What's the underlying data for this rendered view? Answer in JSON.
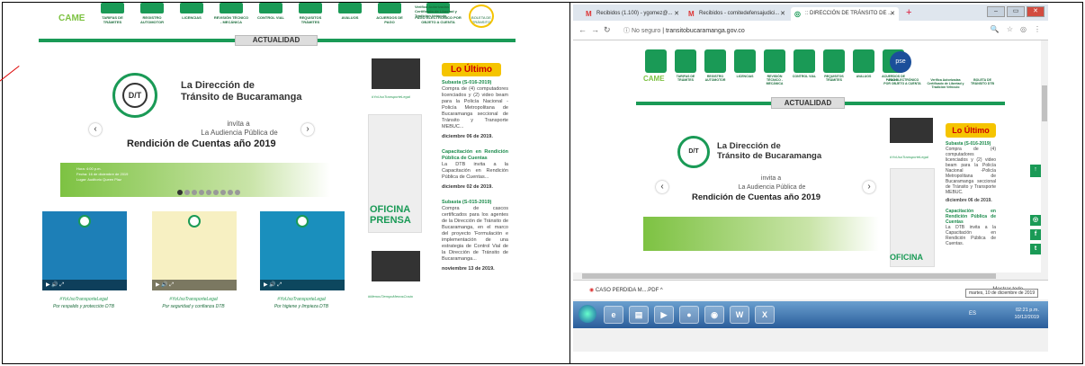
{
  "left": {
    "nav_items": [
      "TARIFAS DE TRÁMITES",
      "REGISTRO AUTOMOTOR",
      "LICENCIAS",
      "REVISIÓN TÉCNICO - MECÁNICA",
      "CONTROL VIAL",
      "REQUISITOS TRÁMITES",
      "AVALUOS",
      "ACUERDOS DE PAGO",
      "PAGO ELECTRÓNICO POR OBJETO A CUENTA"
    ],
    "came": "CAME",
    "verificate": "Verifica Autorizadas Certificado de Libertad y Tradición Vehículo",
    "boleta": "BOLETA DE TRÁNSITO",
    "actualidad": "ACTUALIDAD",
    "slider": {
      "title_line1": "La Dirección de",
      "title_line2": "Tránsito de Bucaramanga",
      "invita": "invita a",
      "audiencia": "La Audiencia Pública de",
      "rendicion": "Rendición de Cuentas año 2019",
      "hora": "Hora: 4:00 p.m.",
      "fecha": "Fecha: 16 de diciembre de 2019",
      "lugar": "Lugar: Auditorio Queen Plaz"
    },
    "videos": [
      {
        "hashtag": "#YoUsoTransporteLegal",
        "caption": "Por respaldo y protección DTB"
      },
      {
        "hashtag": "#YoUsoTransporteLegal",
        "caption": "Por seguridad y confianza DTB"
      },
      {
        "hashtag": "#YoUsoTransporteLegal",
        "caption": "Por higiene y limpieza DTB"
      }
    ],
    "mini_hashtag1": "#YoUsoTransporteLegal",
    "mini_hashtag2": "#MenosTiempoMenosCosto",
    "oficina": "OFICINA PRENSA",
    "lo_ultimo": "Lo Último",
    "news": [
      {
        "title": "Subasta (S-016-2019)",
        "body": "Compra de (4) computadores licenciados y (2) video beam para la Policía Nacional -Policía Metropolitana de Bucaramanga seccional de Tránsito y Transporte MEBUC...",
        "date": "diciembre 06 de 2019."
      },
      {
        "title": "Capacitación en Rendición Pública de Cuentas",
        "body": "La DTB invita a la Capacitación en Rendición Pública de Cuentas...",
        "date": "diciembre 02 de 2019."
      },
      {
        "title": "Subasta (S-015-2019)",
        "body": "Compra de cascos certificados para los agentes de la Dirección de Tránsito de Bucaramanga, en el marco del proyecto 'Formulación e implementación de una estrategia de Control Vial de la Dirección de Tránsito de Bucaramanga...",
        "date": "noviembre 13 de 2019."
      }
    ]
  },
  "right": {
    "tabs": [
      {
        "icon": "M",
        "label": "Recibidos (1.100) - ygomez@..."
      },
      {
        "icon": "M",
        "label": "Recibidos - comitedefensajudici..."
      },
      {
        "icon": "◎",
        "label": ":: DIRECCIÓN DE TRÁNSITO DE ..."
      }
    ],
    "url_security": "No seguro",
    "url": "transitobucaramanga.gov.co",
    "nav_items": [
      "TARIFAS DE TRÁMITES",
      "REGISTRO AUTOMOTOR",
      "LICENCIAS",
      "REVISIÓN TÉCNICO - MECÁNICA",
      "CONTROL VIAL",
      "REQUISITOS TRÁMITES",
      "AVALUOS",
      "ACUERDOS DE PAGO"
    ],
    "came": "CAME",
    "pse": "pse",
    "pago": "PAGO ELECTRÓNICO POR OBJETO A CUENTA",
    "certificado": "Verifica Autorizadas Certificado de Libertad y Tradición Vehículo",
    "boleta": "BOLETA DE TRÁNSITO DTB",
    "actualidad": "ACTUALIDAD",
    "slider": {
      "title_line1": "La Dirección de",
      "title_line2": "Tránsito de Bucaramanga",
      "invita": "invita a",
      "audiencia": "La Audiencia Pública de",
      "rendicion": "Rendición de Cuentas año 2019"
    },
    "hashtag": "#YoUsoTransporteLegal",
    "oficina": "OFICINA",
    "lo_ultimo": "Lo Último",
    "news": [
      {
        "title": "Subasta (S-016-2019)",
        "body": "Compra de (4) computadores licenciados y (2) video beam para la Policía Nacional -Policía Metropolitana de Bucaramanga seccional de Tránsito y Transporte MEBUC.",
        "date": "diciembre 06 de 2019."
      },
      {
        "title": "Capacitación en Rendición Pública de Cuentas",
        "body": "La DTB invita a la Capacitación en Rendición Pública de Cuentas.",
        "date": ""
      }
    ],
    "download": "CASO PERDIDA M....PDF",
    "show_all": "Mostrar todo",
    "tooltip": "martes, 10 de diciembre de 2019",
    "lang": "ES",
    "time": "02:21 p.m.",
    "date": "10/12/2019"
  }
}
